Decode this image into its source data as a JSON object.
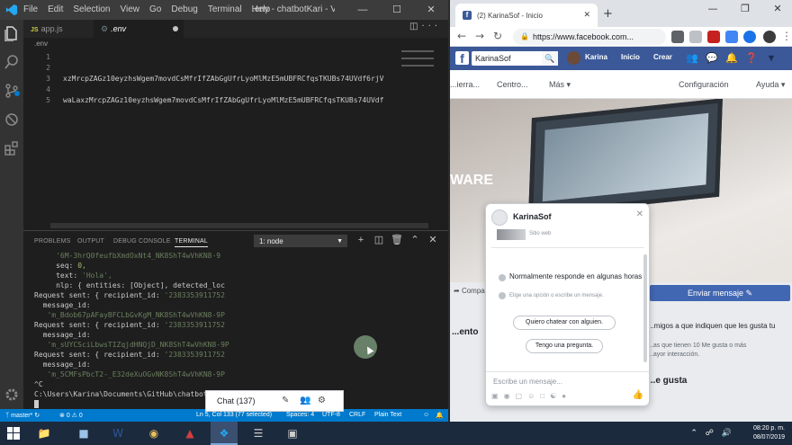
{
  "vscode": {
    "menu": [
      "File",
      "Edit",
      "Selection",
      "View",
      "Go",
      "Debug",
      "Terminal",
      "Help"
    ],
    "window_title": ".env - chatbotKari - Visual Studio C...",
    "tabs": [
      {
        "label": "app.js",
        "icon": "JS"
      },
      {
        "label": ".env",
        "icon": "gear"
      }
    ],
    "breadcrumb": ".env",
    "lines": [
      {
        "n": "1",
        "text": ""
      },
      {
        "n": "2",
        "text": ""
      },
      {
        "n": "3",
        "text": "xzMrcpZAGz10eyzhsWgem7movdCsMfrIfZAbGgUfrLyoMlMzE5mUBFRCfqsTKUBs74UVdf6rjV"
      },
      {
        "n": "4",
        "text": ""
      },
      {
        "n": "5",
        "text": "waLaxzMrcpZAGz10eyzhsWgem7movdCsMfrIfZAbGgUfrLyoMlMzE5mUBFRCfqsTKUBs74UVdf"
      }
    ],
    "panel": {
      "tabs": [
        "PROBLEMS",
        "OUTPUT",
        "DEBUG CONSOLE",
        "TERMINAL"
      ],
      "terminal_select": "1: node"
    },
    "terminal": {
      "l1": "'6M-3hrQ0feufbXmdOxNt4_NK8ShT4wVhKN8-9",
      "l2a": "seq: ",
      "l2b": "0,",
      "l3a": "text: ",
      "l3b": "'Hola',",
      "l4": "nlp: { entities: [Object], detected_loc",
      "rs": "Request sent: { recipient_id: ",
      "rid": "'2383353911752",
      "mid": "message_id:",
      "m1": "'m_Bdob67pAFayBFCLbGvKgM_NK8ShT4wVhKN8-9P",
      "m2": "'m_sUYCSciLbwsTIZqjdHNQjD_NK8ShT4wVhKN8-9P",
      "m3": "'m_5CMFsPbcT2-_E32deXuOGvNK8ShT4wVhKN8-9P",
      "ctrlc": "^C",
      "prompt": "C:\\Users\\Karina\\Documents\\GitHub\\chatbotKari>node app.js"
    },
    "status": {
      "branch": "master*",
      "errors": "0",
      "warnings": "0",
      "position": "Ln 5, Col 133 (77 selected)",
      "spaces": "Spaces: 4",
      "encoding": "UTF-8",
      "eol": "CRLF",
      "language": "Plain Text"
    }
  },
  "chrome": {
    "tab_title": "(2) KarinaSof - Inicio",
    "url": "https://www.facebook.com...",
    "fb": {
      "search_value": "KarinaSof",
      "user": "Karina",
      "inicio": "Inicio",
      "crear": "Crear",
      "subnav": [
        "...ierra...",
        "Centro...",
        "Más ▾",
        "Configuración",
        "Ayuda ▾"
      ],
      "cover_text": "WARE",
      "compartir": "Compa",
      "enviar": "Enviar mensaje ✎",
      "recientes": "...ento",
      "amigos": "...migos a que indiquen que les gusta tu",
      "tienen": "...as que tienen 10 Me gusta o más",
      "interaccion": "...ayor interacción.",
      "gusta": "...e gusta",
      "chat": "Chat (137)"
    },
    "messenger": {
      "name": "KarinaSof",
      "sitio": "Sitio web",
      "responde": "Normalmente responde en algunas horas",
      "elige": "Elige una opción o escribe un mensaje.",
      "q1": "Quiero chatear con alguien.",
      "q2": "Tengo una pregunta.",
      "placeholder": "Escribe un mensaje..."
    }
  },
  "taskbar": {
    "time": "08:20 p. m.",
    "date": "08/07/2019"
  },
  "colors": {
    "vscode_bg": "#1e1e1e",
    "statusbar": "#007acc",
    "fb_blue": "#3b5998",
    "fb_button": "#4267b2"
  }
}
